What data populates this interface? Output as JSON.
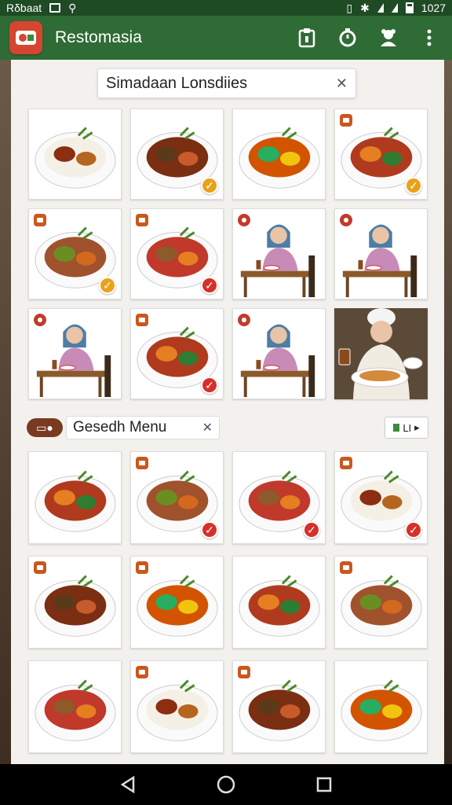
{
  "status_bar": {
    "carrier": "Rδbaat",
    "time": "1027"
  },
  "app": {
    "title": "Restomasia",
    "brand_color": "#2f6b34"
  },
  "search": {
    "value": "Simadaan Lonsdiies",
    "clear_icon": "close-icon"
  },
  "section": {
    "label": "Gesedh Menu",
    "clear_icon": "close-icon",
    "toggle_label": "LI"
  },
  "top_grid": [
    {
      "kind": "dish",
      "badge": false,
      "check": false
    },
    {
      "kind": "dish",
      "badge": false,
      "check": "orange"
    },
    {
      "kind": "dish",
      "badge": false,
      "check": false
    },
    {
      "kind": "dish",
      "badge": true,
      "check": "orange"
    },
    {
      "kind": "dish",
      "badge": true,
      "check": "orange"
    },
    {
      "kind": "dish",
      "badge": true,
      "check": "red"
    },
    {
      "kind": "person",
      "badge": true,
      "check": false
    },
    {
      "kind": "person",
      "badge": true,
      "check": false
    },
    {
      "kind": "person",
      "badge": true,
      "check": false
    },
    {
      "kind": "dish",
      "badge": true,
      "check": "red"
    },
    {
      "kind": "person",
      "badge": true,
      "check": false
    },
    {
      "kind": "chef",
      "badge": false,
      "check": false
    }
  ],
  "bottom_grid": [
    {
      "badge": false,
      "check": false
    },
    {
      "badge": true,
      "check": "red"
    },
    {
      "badge": false,
      "check": "red"
    },
    {
      "badge": true,
      "check": "red"
    },
    {
      "badge": true,
      "check": false
    },
    {
      "badge": true,
      "check": false
    },
    {
      "badge": false,
      "check": false
    },
    {
      "badge": true,
      "check": false
    },
    {
      "badge": false,
      "check": false
    },
    {
      "badge": true,
      "check": false
    },
    {
      "badge": true,
      "check": false
    },
    {
      "badge": false,
      "check": false
    }
  ]
}
